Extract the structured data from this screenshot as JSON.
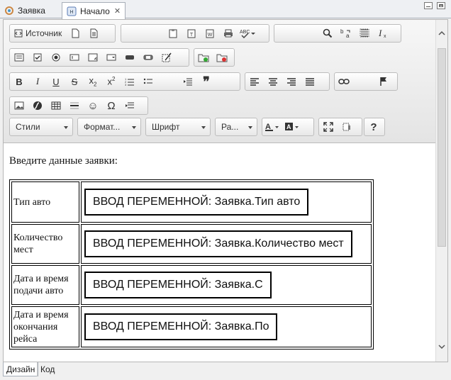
{
  "tabs": [
    {
      "label": "Заявка",
      "active": false
    },
    {
      "label": "Начало",
      "active": true
    }
  ],
  "toolbar": {
    "source_label": "Источник",
    "styles_label": "Стили",
    "format_label": "Формат...",
    "font_label": "Шрифт",
    "size_label": "Ра..."
  },
  "content": {
    "intro": "Введите данные заявки:",
    "rows": [
      {
        "label": "Тип авто",
        "value": "ВВОД ПЕРЕМЕННОЙ: Заявка.Тип авто"
      },
      {
        "label": "Количество мест",
        "value": "ВВОД ПЕРЕМЕННОЙ: Заявка.Количество мест"
      },
      {
        "label": "Дата и время подачи авто",
        "value": "ВВОД ПЕРЕМЕННОЙ: Заявка.С"
      },
      {
        "label": "Дата и время окончания рейса",
        "value": "ВВОД ПЕРЕМЕННОЙ: Заявка.По"
      }
    ]
  },
  "bottom_tabs": [
    {
      "label": "Дизайн",
      "active": true
    },
    {
      "label": "Код",
      "active": false
    }
  ],
  "colors": {
    "border": "#bdbdbd",
    "tab_border": "#a7aeb8",
    "text": "#222222"
  }
}
